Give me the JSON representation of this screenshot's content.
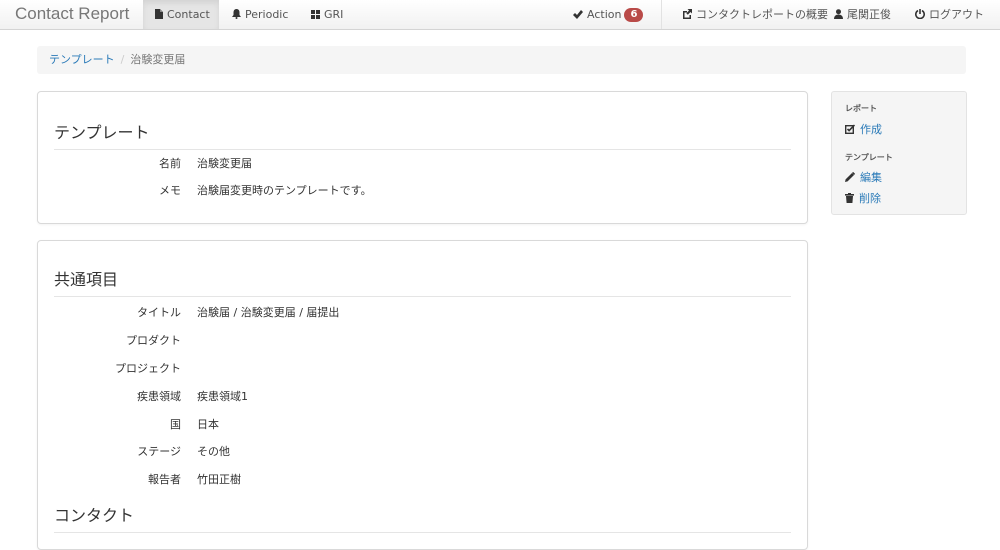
{
  "navbar": {
    "brand": "Contact Report",
    "tabs": [
      {
        "label": "Contact",
        "icon": "file-icon"
      },
      {
        "label": "Periodic",
        "icon": "bell-icon"
      },
      {
        "label": "GRI",
        "icon": "grid-icon"
      }
    ],
    "action_label": "Action",
    "action_count": "6",
    "overview_label": "コンタクトレポートの概要",
    "user_label": "尾関正俊",
    "logout_label": "ログアウト"
  },
  "breadcrumb": {
    "parent": "テンプレート",
    "separator": "/",
    "current": "治験変更届"
  },
  "template_panel": {
    "title": "テンプレート",
    "rows": [
      {
        "label": "名前",
        "value": "治験変更届"
      },
      {
        "label": "メモ",
        "value": "治験届変更時のテンプレートです。"
      }
    ]
  },
  "common_panel": {
    "title": "共通項目",
    "rows": [
      {
        "label": "タイトル",
        "value": "治験届 / 治験変更届 / 届提出"
      },
      {
        "label": "プロダクト",
        "value": ""
      },
      {
        "label": "プロジェクト",
        "value": ""
      },
      {
        "label": "疾患領域",
        "value": "疾患領域1"
      },
      {
        "label": "国",
        "value": "日本"
      },
      {
        "label": "ステージ",
        "value": "その他"
      },
      {
        "label": "報告者",
        "value": "竹田正樹"
      }
    ],
    "contact_heading": "コンタクト"
  },
  "sidebar": {
    "report_heading": "レポート",
    "create_label": "作成",
    "template_heading": "テンプレート",
    "edit_label": "編集",
    "delete_label": "削除"
  },
  "colors": {
    "link": "#2a7ab8",
    "badge": "#b94a48",
    "navbar_active": "#e5e5e5"
  }
}
